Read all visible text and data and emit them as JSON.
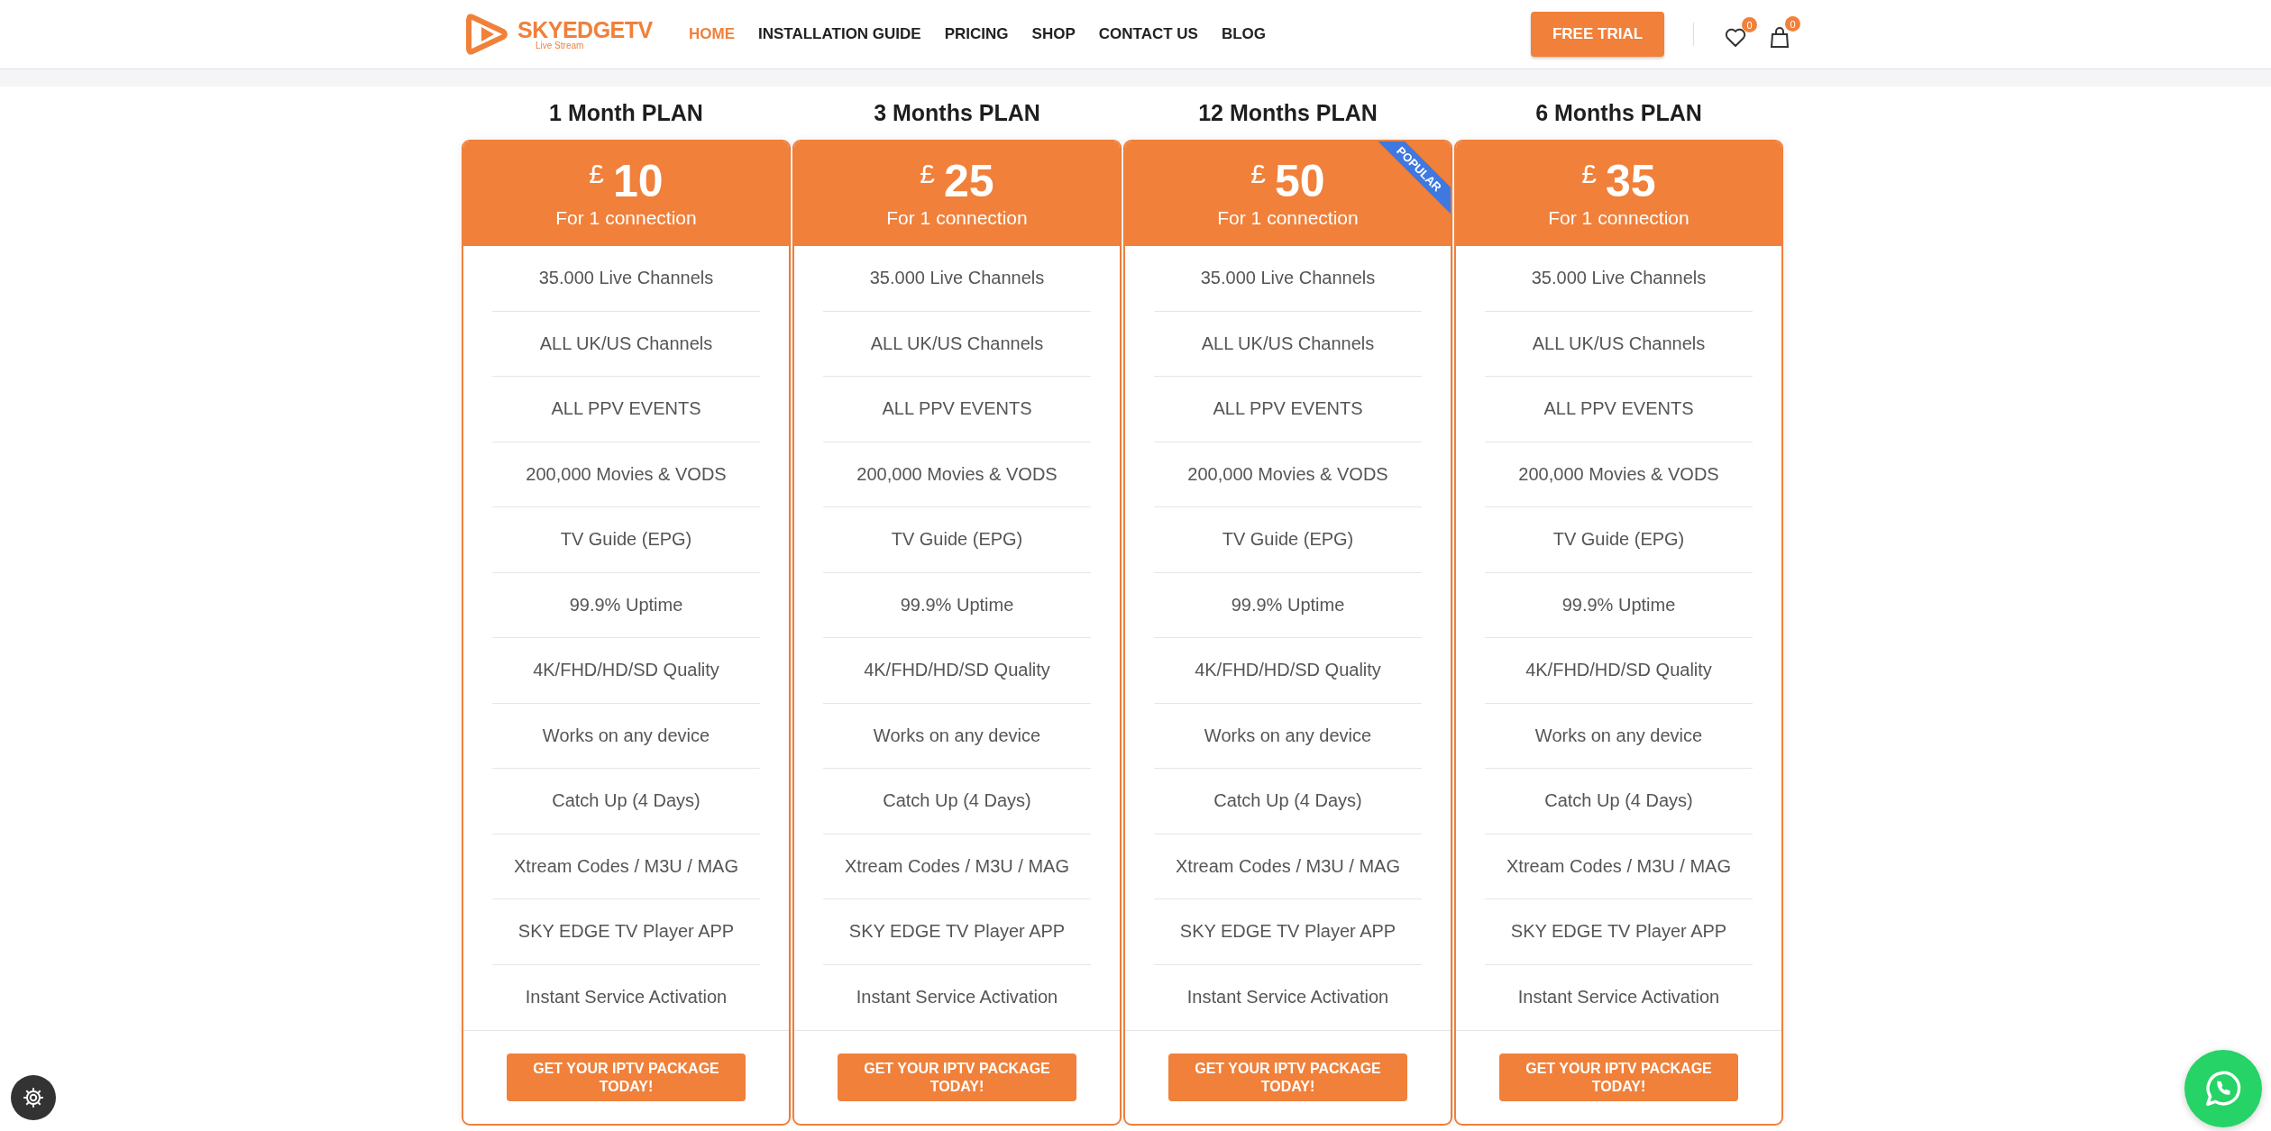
{
  "header": {
    "logo": {
      "name": "SKYEDGETV",
      "tagline": "Live Stream"
    },
    "nav": [
      {
        "label": "HOME",
        "selected": true
      },
      {
        "label": "INSTALLATION GUIDE",
        "selected": false
      },
      {
        "label": "PRICING",
        "selected": false
      },
      {
        "label": "SHOP",
        "selected": false
      },
      {
        "label": "CONTACT US",
        "selected": false
      },
      {
        "label": "BLOG",
        "selected": false
      }
    ],
    "cta": "FREE TRIAL",
    "wishlist_count": "0",
    "cart_count": "0"
  },
  "plans": [
    {
      "title": "1 Month PLAN",
      "currency": "£",
      "price": "10",
      "subtitle": "For 1 connection",
      "features": [
        "35.000 Live Channels",
        "ALL UK/US Channels",
        "ALL PPV EVENTS",
        "200,000 Movies & VODS",
        "TV Guide (EPG)",
        "99.9% Uptime",
        "4K/FHD/HD/SD Quality",
        "Works on any device",
        "Catch Up (4 Days)",
        "Xtream Codes / M3U / MAG",
        "SKY EDGE TV Player APP",
        "Instant Service Activation"
      ],
      "button": "GET YOUR IPTV PACKAGE TODAY!"
    },
    {
      "title": "3 Months PLAN",
      "currency": "£",
      "price": "25",
      "subtitle": "For 1 connection",
      "features": [
        "35.000 Live Channels",
        "ALL UK/US Channels",
        "ALL PPV EVENTS",
        "200,000 Movies & VODS",
        "TV Guide (EPG)",
        "99.9% Uptime",
        "4K/FHD/HD/SD Quality",
        "Works on any device",
        "Catch Up (4 Days)",
        "Xtream Codes / M3U / MAG",
        "SKY EDGE TV Player APP",
        "Instant Service Activation"
      ],
      "button": "GET YOUR IPTV PACKAGE TODAY!"
    },
    {
      "title": "12 Months PLAN",
      "currency": "£",
      "price": "50",
      "subtitle": "For 1 connection",
      "ribbon": "POPULAR",
      "features": [
        "35.000 Live Channels",
        "ALL UK/US Channels",
        "ALL PPV EVENTS",
        "200,000 Movies & VODS",
        "TV Guide (EPG)",
        "99.9% Uptime",
        "4K/FHD/HD/SD Quality",
        "Works on any device",
        "Catch Up (4 Days)",
        "Xtream Codes / M3U / MAG",
        "SKY EDGE TV Player APP",
        "Instant Service Activation"
      ],
      "button": "GET YOUR IPTV PACKAGE TODAY!"
    },
    {
      "title": "6 Months PLAN",
      "currency": "£",
      "price": "35",
      "subtitle": "For 1 connection",
      "features": [
        "35.000 Live Channels",
        "ALL UK/US Channels",
        "ALL PPV EVENTS",
        "200,000 Movies & VODS",
        "TV Guide (EPG)",
        "99.9% Uptime",
        "4K/FHD/HD/SD Quality",
        "Works on any device",
        "Catch Up (4 Days)",
        "Xtream Codes / M3U / MAG",
        "SKY EDGE TV Player APP",
        "Instant Service Activation"
      ],
      "button": "GET YOUR IPTV PACKAGE TODAY!"
    }
  ]
}
